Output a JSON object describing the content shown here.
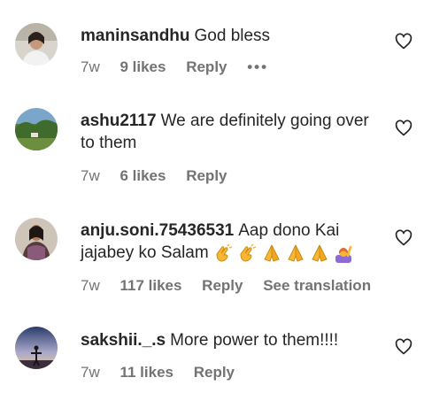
{
  "comments": [
    {
      "username": "maninsandhu",
      "text": "God bless",
      "time": "7w",
      "likes": "9 likes",
      "reply": "Reply",
      "more": "•••"
    },
    {
      "username": "ashu2117",
      "text": "We are definitely going over to them",
      "time": "7w",
      "likes": "6 likes",
      "reply": "Reply"
    },
    {
      "username": "anju.soni.75436531",
      "text": "Aap dono Kai jajabey ko Salam",
      "emojis": [
        "clapping-hands-emoji",
        "clapping-hands-emoji",
        "folded-hands-emoji",
        "folded-hands-emoji",
        "folded-hands-emoji",
        "person-raising-hand-emoji"
      ],
      "time": "7w",
      "likes": "117 likes",
      "reply": "Reply",
      "translation": "See translation"
    },
    {
      "username": "sakshii._.s",
      "text": "More power to them!!!!",
      "time": "7w",
      "likes": "11 likes",
      "reply": "Reply"
    }
  ],
  "colors": {
    "text": "#262626",
    "meta": "#737373"
  }
}
